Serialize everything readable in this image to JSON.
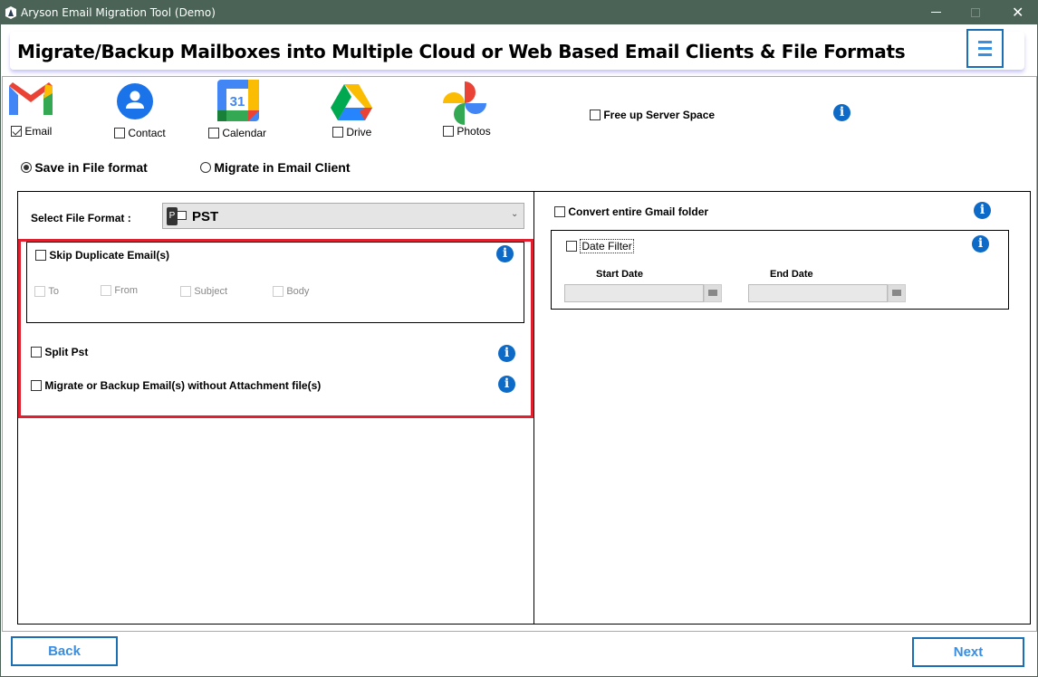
{
  "window": {
    "title": "Aryson Email Migration Tool (Demo)"
  },
  "header": {
    "title": "Migrate/Backup Mailboxes into Multiple Cloud or Web Based Email Clients & File Formats"
  },
  "services": [
    {
      "label": "Email",
      "checked": true,
      "icon": "gmail-icon"
    },
    {
      "label": "Contact",
      "checked": false,
      "icon": "contacts-icon"
    },
    {
      "label": "Calendar",
      "checked": false,
      "icon": "calendar-icon"
    },
    {
      "label": "Drive",
      "checked": false,
      "icon": "drive-icon"
    },
    {
      "label": "Photos",
      "checked": false,
      "icon": "photos-icon"
    }
  ],
  "calendar_day": "31",
  "free_space": {
    "label": "Free up Server Space",
    "checked": false
  },
  "mode": {
    "file_format": "Save in File format",
    "email_client": "Migrate in Email Client",
    "selected": "file_format"
  },
  "left": {
    "format_label": "Select File Format :",
    "format_value": "PST",
    "skip_duplicate": "Skip Duplicate Email(s)",
    "dup_fields": [
      "To",
      "From",
      "Subject",
      "Body"
    ],
    "split_pst": "Split Pst",
    "no_attachment": "Migrate or Backup Email(s) without Attachment file(s)"
  },
  "right": {
    "convert_gmail": "Convert entire Gmail folder",
    "date_filter": "Date Filter",
    "start_date": "Start Date",
    "end_date": "End Date"
  },
  "footer": {
    "back": "Back",
    "next": "Next"
  },
  "colors": {
    "titlebar": "#4a6356",
    "accent": "#1a6fb5",
    "highlight": "#e0202e",
    "info": "#0d6ac6"
  }
}
